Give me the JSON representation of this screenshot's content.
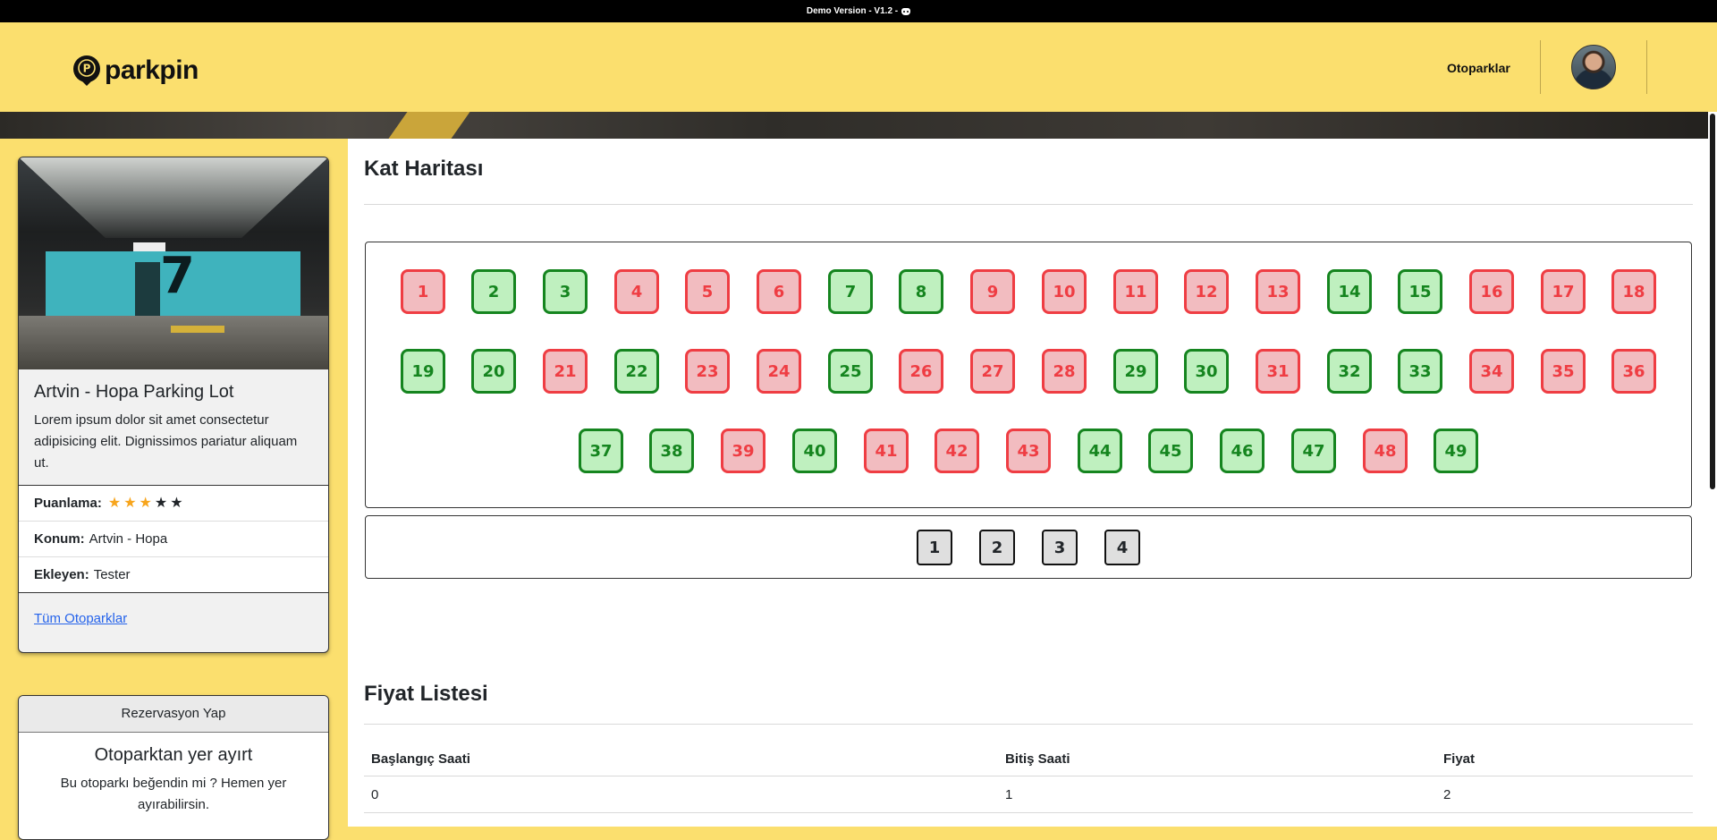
{
  "banner": {
    "text": "Demo Version - V1.2 -",
    "icon": "discord-icon"
  },
  "brand": {
    "name": "parkpin",
    "icon": "parking-pin-icon"
  },
  "nav": {
    "link": "Otoparklar",
    "avatar": "user-avatar"
  },
  "parking": {
    "title": "Artvin - Hopa Parking Lot",
    "description": "Lorem ipsum dolor sit amet consectetur adipisicing elit. Dignissimos pariatur aliquam ut.",
    "rating_label": "Puanlama:",
    "rating": 3,
    "rating_max": 5,
    "location_label": "Konum:",
    "location": "Artvin - Hopa",
    "added_by_label": "Ekleyen:",
    "added_by": "Tester",
    "all_link": "Tüm Otoparklar"
  },
  "reservation": {
    "header": "Rezervasyon Yap",
    "title": "Otoparktan yer ayırt",
    "text": "Bu otoparkı beğendin mi ? Hemen yer ayırabilirsin."
  },
  "floor_map": {
    "title": "Kat Haritası",
    "slots": [
      {
        "n": "1",
        "s": "busy"
      },
      {
        "n": "2",
        "s": "free"
      },
      {
        "n": "3",
        "s": "free"
      },
      {
        "n": "4",
        "s": "busy"
      },
      {
        "n": "5",
        "s": "busy"
      },
      {
        "n": "6",
        "s": "busy"
      },
      {
        "n": "7",
        "s": "free"
      },
      {
        "n": "8",
        "s": "free"
      },
      {
        "n": "9",
        "s": "busy"
      },
      {
        "n": "10",
        "s": "busy"
      },
      {
        "n": "11",
        "s": "busy"
      },
      {
        "n": "12",
        "s": "busy"
      },
      {
        "n": "13",
        "s": "busy"
      },
      {
        "n": "14",
        "s": "free"
      },
      {
        "n": "15",
        "s": "free"
      },
      {
        "n": "16",
        "s": "busy"
      },
      {
        "n": "17",
        "s": "busy"
      },
      {
        "n": "18",
        "s": "busy"
      },
      {
        "n": "19",
        "s": "free"
      },
      {
        "n": "20",
        "s": "free"
      },
      {
        "n": "21",
        "s": "busy"
      },
      {
        "n": "22",
        "s": "free"
      },
      {
        "n": "23",
        "s": "busy"
      },
      {
        "n": "24",
        "s": "busy"
      },
      {
        "n": "25",
        "s": "free"
      },
      {
        "n": "26",
        "s": "busy"
      },
      {
        "n": "27",
        "s": "busy"
      },
      {
        "n": "28",
        "s": "busy"
      },
      {
        "n": "29",
        "s": "free"
      },
      {
        "n": "30",
        "s": "free"
      },
      {
        "n": "31",
        "s": "busy"
      },
      {
        "n": "32",
        "s": "free"
      },
      {
        "n": "33",
        "s": "free"
      },
      {
        "n": "34",
        "s": "busy"
      },
      {
        "n": "35",
        "s": "busy"
      },
      {
        "n": "36",
        "s": "busy"
      },
      {
        "n": "37",
        "s": "free"
      },
      {
        "n": "38",
        "s": "free"
      },
      {
        "n": "39",
        "s": "busy"
      },
      {
        "n": "40",
        "s": "free"
      },
      {
        "n": "41",
        "s": "busy"
      },
      {
        "n": "42",
        "s": "busy"
      },
      {
        "n": "43",
        "s": "busy"
      },
      {
        "n": "44",
        "s": "free"
      },
      {
        "n": "45",
        "s": "free"
      },
      {
        "n": "46",
        "s": "free"
      },
      {
        "n": "47",
        "s": "free"
      },
      {
        "n": "48",
        "s": "busy"
      },
      {
        "n": "49",
        "s": "free"
      }
    ],
    "floors": [
      "1",
      "2",
      "3",
      "4"
    ]
  },
  "price_list": {
    "title": "Fiyat Listesi",
    "headers": [
      "Başlangıç Saati",
      "Bitiş Saati",
      "Fiyat"
    ],
    "rows": [
      [
        "0",
        "1",
        "2"
      ]
    ]
  },
  "colors": {
    "brand_yellow": "#fbdf6e",
    "free": "#15851f",
    "busy": "#ef3d43"
  }
}
